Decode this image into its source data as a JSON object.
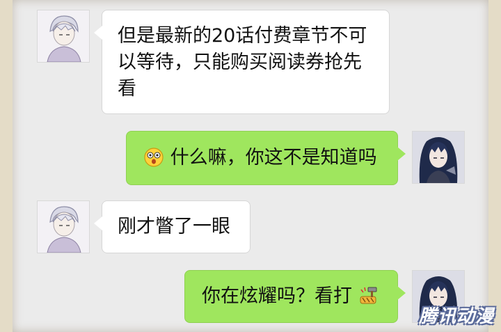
{
  "messages": [
    {
      "side": "left",
      "avatar": "white-haired-character-avatar",
      "text": "但是最新的20话付费章节不可以等待，只能购买阅读券抢先看"
    },
    {
      "side": "right",
      "avatar": "dark-haired-character-avatar",
      "emoji": "surprised-face-emoji",
      "text": "什么嘛，你这不是知道吗"
    },
    {
      "side": "left",
      "avatar": "white-haired-character-avatar",
      "text": "刚才瞥了一眼"
    },
    {
      "side": "right",
      "avatar": "dark-haired-character-avatar",
      "emoji": "hammer-punch-emoji",
      "text": "你在炫耀吗？看打"
    }
  ],
  "watermark": "腾讯动漫",
  "colors": {
    "left_bubble": "#ffffff",
    "right_bubble": "#9fe65e",
    "chat_bg": "#ebebeb",
    "frame_bg": "#e4dcc7"
  }
}
